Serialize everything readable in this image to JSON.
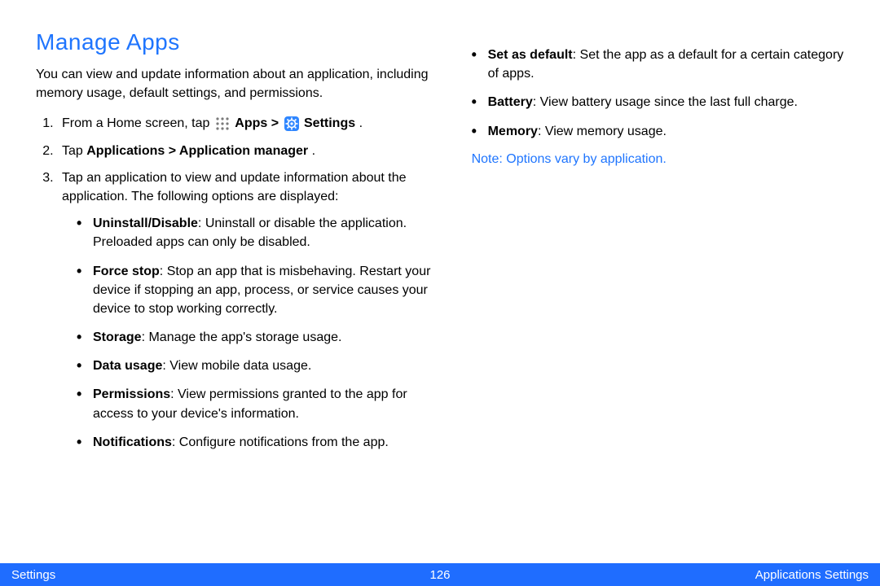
{
  "heading": "Manage Apps",
  "intro": "You can view and update information about an application, including memory usage, default settings, and permissions.",
  "steps": {
    "s1_prefix": "From a Home screen, tap ",
    "s1_apps": "Apps",
    "s1_gt": " > ",
    "s1_settings": "Settings",
    "s1_dot": " .",
    "s2_prefix": "Tap ",
    "s2_bold": "Applications > Application manager",
    "s2_dot": ".",
    "s3": "Tap an application to view and update information about the application. The following options are displayed:"
  },
  "bullets_left": [
    {
      "term": "Uninstall/Disable",
      "desc": ": Uninstall or disable the application. Preloaded apps can only be disabled."
    },
    {
      "term": "Force stop",
      "desc": ": Stop an app that is misbehaving. Restart your device if stopping an app, process, or service causes your device to stop working correctly."
    },
    {
      "term": "Storage",
      "desc": ": Manage the app's storage usage."
    },
    {
      "term": "Data usage",
      "desc": ": View mobile data usage."
    },
    {
      "term": "Permissions",
      "desc": ": View permissions granted to the app for access to your device's information."
    },
    {
      "term": "Notifications",
      "desc": ": Configure notifications from the app."
    }
  ],
  "bullets_right": [
    {
      "term": "Set as default",
      "desc": ": Set the app as a default for a certain category of apps."
    },
    {
      "term": "Battery",
      "desc": ": View battery usage since the last full charge."
    },
    {
      "term": "Memory",
      "desc": ": View memory usage."
    }
  ],
  "note_label": "Note",
  "note_text": ": Options vary by application.",
  "footer": {
    "left": "Settings",
    "center": "126",
    "right": "Applications Settings"
  }
}
